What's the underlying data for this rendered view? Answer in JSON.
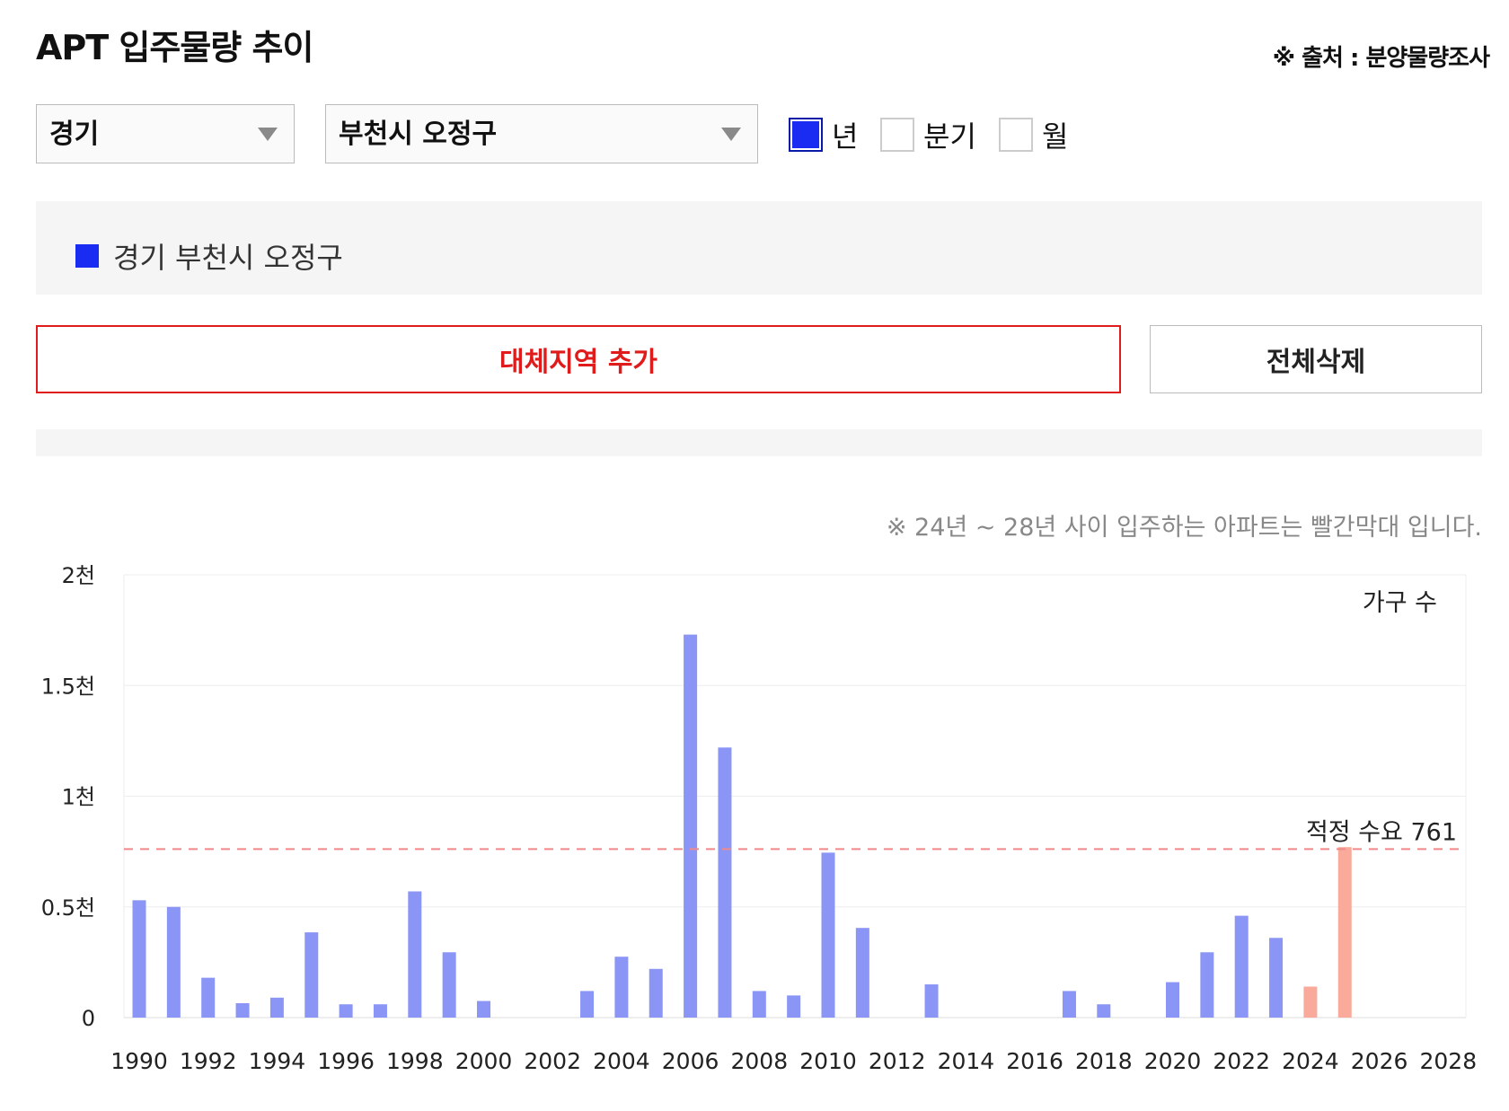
{
  "header": {
    "title": "APT 입주물량 추이",
    "source": "※ 출처 : 분양물량조사"
  },
  "filters": {
    "region": "경기",
    "subregion": "부천시 오정구",
    "periods": [
      {
        "label": "년",
        "checked": true
      },
      {
        "label": "분기",
        "checked": false
      },
      {
        "label": "월",
        "checked": false
      }
    ]
  },
  "legend": {
    "label": "경기 부천시 오정구",
    "color": "#1a2cf2"
  },
  "buttons": {
    "add_label": "대체지역 추가",
    "delete_label": "전체삭제"
  },
  "note": "※ 24년 ~ 28년 사이 입주하는 아파트는 빨간막대 입니다.",
  "colors": {
    "past": "#8a95f5",
    "future": "#f9aa9a",
    "ref": "#f08a8a",
    "accent": "#e01b1b"
  },
  "chart_data": {
    "type": "bar",
    "unit_label": "가구 수",
    "ylim": [
      0,
      2000
    ],
    "yticks": [
      {
        "value": 0,
        "label": "0"
      },
      {
        "value": 500,
        "label": "0.5천"
      },
      {
        "value": 1000,
        "label": "1천"
      },
      {
        "value": 1500,
        "label": "1.5천"
      },
      {
        "value": 2000,
        "label": "2천"
      }
    ],
    "xticks": [
      "1990",
      "1992",
      "1994",
      "1996",
      "1998",
      "2000",
      "2002",
      "2004",
      "2006",
      "2008",
      "2010",
      "2012",
      "2014",
      "2016",
      "2018",
      "2020",
      "2022",
      "2024",
      "2026",
      "2028"
    ],
    "reference": {
      "label": "적정 수요 761",
      "value": 761
    },
    "years": [
      1990,
      1991,
      1992,
      1993,
      1994,
      1995,
      1996,
      1997,
      1998,
      1999,
      2000,
      2001,
      2002,
      2003,
      2004,
      2005,
      2006,
      2007,
      2008,
      2009,
      2010,
      2011,
      2012,
      2013,
      2014,
      2015,
      2016,
      2017,
      2018,
      2019,
      2020,
      2021,
      2022,
      2023,
      2024,
      2025,
      2026,
      2027,
      2028
    ],
    "values": [
      530,
      500,
      180,
      65,
      90,
      385,
      60,
      60,
      570,
      295,
      75,
      0,
      0,
      120,
      275,
      220,
      1730,
      1220,
      120,
      100,
      745,
      405,
      0,
      150,
      0,
      0,
      0,
      120,
      60,
      0,
      160,
      295,
      460,
      360,
      140,
      770,
      0,
      0,
      0
    ],
    "future_years": [
      2024,
      2025,
      2026,
      2027,
      2028
    ],
    "grid": true
  }
}
